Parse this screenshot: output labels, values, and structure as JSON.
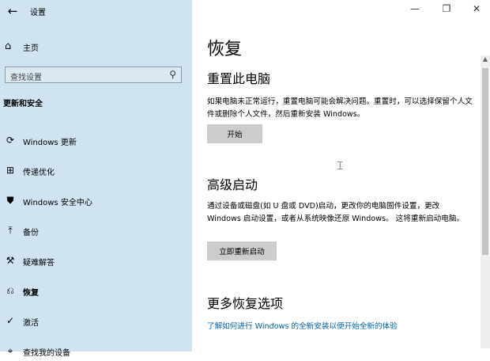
{
  "window": {
    "app_title": "设置",
    "controls": {
      "minimize": "—",
      "maximize": "❐",
      "close": "✕"
    }
  },
  "sidebar": {
    "home_label": "主页",
    "search_placeholder": "查找设置",
    "section_title": "更新和安全",
    "items": [
      {
        "label": "Windows 更新",
        "icon": "refresh-icon"
      },
      {
        "label": "传递优化",
        "icon": "delivery-optimization-icon"
      },
      {
        "label": "Windows 安全中心",
        "icon": "shield-icon"
      },
      {
        "label": "备份",
        "icon": "backup-icon"
      },
      {
        "label": "疑难解答",
        "icon": "wrench-icon"
      },
      {
        "label": "恢复",
        "icon": "recovery-icon"
      },
      {
        "label": "激活",
        "icon": "checkmark-circle-icon"
      },
      {
        "label": "查找我的设备",
        "icon": "find-device-icon"
      }
    ]
  },
  "main": {
    "page_title": "恢复",
    "reset": {
      "heading": "重置此电脑",
      "description": "如果电脑未正常运行，重置电脑可能会解决问题。重置时，可以选择保留个人文件或删除个人文件，然后重新安装 Windows。",
      "button": "开始"
    },
    "advanced": {
      "heading": "高级启动",
      "description": "通过设备或磁盘(如 U 盘或 DVD)启动，更改你的电脑固件设置，更改 Windows 启动设置，或者从系统映像还原 Windows。  这将重新启动电脑。",
      "button": "立即重新启动"
    },
    "more": {
      "heading": "更多恢复选项",
      "link": "了解如何进行 Windows 的全新安装以便开始全新的体验"
    }
  }
}
